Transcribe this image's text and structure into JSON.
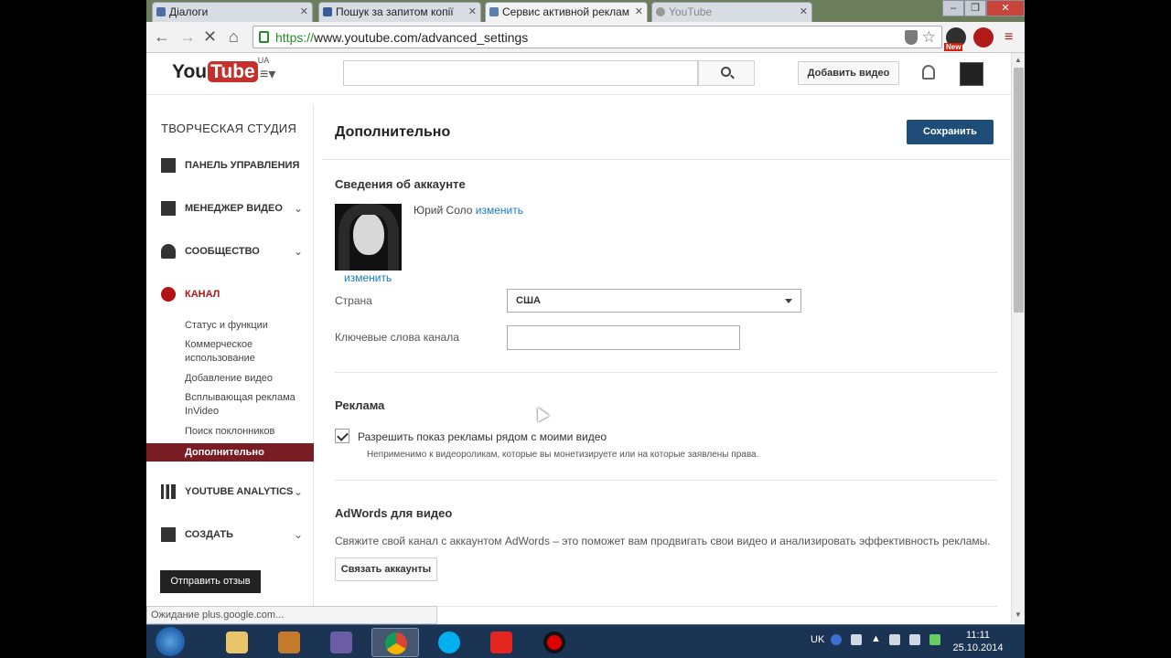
{
  "browser": {
    "tabs": [
      {
        "label": "Діалоги"
      },
      {
        "label": "Пошук за запитом копії"
      },
      {
        "label": "Сервис активной реклам"
      },
      {
        "label": "YouTube"
      }
    ],
    "url_proto": "https://",
    "url_rest": "www.youtube.com/advanced_settings",
    "ext_badge": "New"
  },
  "header": {
    "logo_you": "You",
    "logo_tube": "Tube",
    "logo_region": "UA",
    "guide_icon": "≡▾",
    "search_placeholder": "",
    "upload_label": "Добавить видео"
  },
  "sidebar": {
    "title": "ТВОРЧЕСКАЯ СТУДИЯ",
    "dashboard": "ПАНЕЛЬ УПРАВЛЕНИЯ",
    "video_manager": "МЕНЕДЖЕР ВИДЕО",
    "community": "СООБЩЕСТВО",
    "channel": "КАНАЛ",
    "channel_subitems": {
      "status": "Статус и функции",
      "monetization": "Коммерческое использование",
      "upload_defaults": "Добавление видео",
      "invideo": "Всплывающая реклама InVideo",
      "fan_finder": "Поиск поклонников",
      "advanced": "Дополнительно"
    },
    "analytics": "YOUTUBE ANALYTICS",
    "create": "СОЗДАТЬ",
    "feedback": "Отправить отзыв"
  },
  "main": {
    "title": "Дополнительно",
    "save_label": "Сохранить",
    "account": {
      "heading": "Сведения об аккаунте",
      "name": "Юрий Соло",
      "change_link": "изменить",
      "avatar_change": "изменить",
      "country_label": "Страна",
      "country_value": "США",
      "keywords_label": "Ключевые слова канала",
      "keywords_value": ""
    },
    "ads": {
      "heading": "Реклама",
      "checkbox_label": "Разрешить показ рекламы рядом с моими видео",
      "checked": true,
      "note": "Неприменимо к видеороликам, которые вы монетизируете или на которые заявлены права."
    },
    "adwords": {
      "heading": "AdWords для видео",
      "description": "Свяжите свой канал с аккаунтом AdWords – это поможет вам продвигать свои видео и анализировать эффективность рекламы.",
      "button": "Связать аккаунты"
    }
  },
  "status_bar": "Ожидание plus.google.com...",
  "taskbar": {
    "lang": "UK",
    "time": "11:11",
    "date": "25.10.2014"
  },
  "colors": {
    "save_button": "#1f4d79",
    "active_nav": "#7a1c24",
    "channel_red": "#b31217",
    "link": "#167ac6"
  }
}
